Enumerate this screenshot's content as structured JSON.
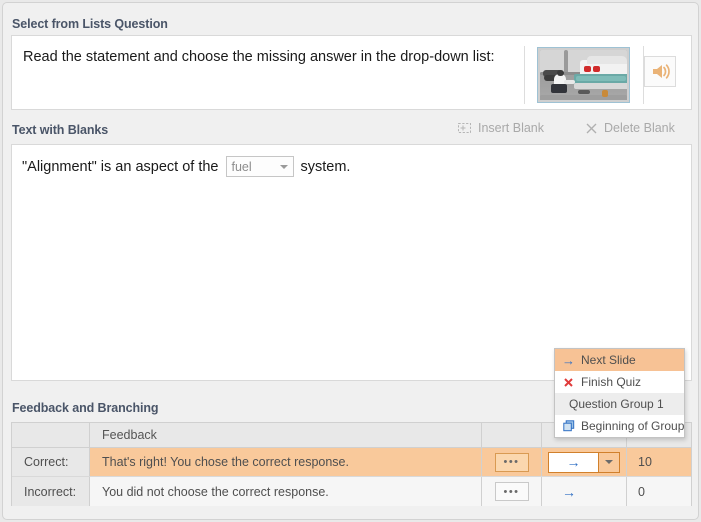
{
  "sections": {
    "question_title": "Select from Lists Question",
    "blanks_title": "Text with Blanks",
    "feedback_title": "Feedback and Branching"
  },
  "statement": {
    "text": "Read the statement and choose the missing answer in the drop-down list:",
    "image_icon": "car-repair-thumbnail",
    "audio_icon": "speaker-icon"
  },
  "blank_toolbar": {
    "insert_icon": "insert-blank-icon",
    "insert_label": "Insert Blank",
    "delete_icon": "close-x-icon",
    "delete_label": "Delete Blank"
  },
  "blanks": {
    "prefix": "\"Alignment\" is an aspect of the",
    "select_value": "fuel",
    "suffix": "system.",
    "chevron_icon": "chevron-down-icon"
  },
  "feedback_table": {
    "headers": [
      "",
      "Feedback",
      "",
      "",
      ""
    ],
    "feedback_header": "Feedback",
    "rows": [
      {
        "label": "Correct:",
        "feedback": "That's right! You chose the correct response.",
        "dots": "•••",
        "branch_icon": "arrow-right-icon",
        "chevron_icon": "chevron-down-icon",
        "score": "10"
      },
      {
        "label": "Incorrect:",
        "feedback": "You did not choose the correct response.",
        "dots": "•••",
        "branch_icon": "arrow-right-icon",
        "chevron_icon": "",
        "score": "0"
      }
    ]
  },
  "branch_popup": {
    "items": [
      {
        "label": "Next Slide",
        "icon": "arrow-right-icon",
        "selected": true
      },
      {
        "label": "Finish Quiz",
        "icon": "close-x-icon",
        "selected": false
      },
      {
        "label": "Question Group 1",
        "icon": "",
        "selected": false
      },
      {
        "label": "Beginning of Group",
        "icon": "layered-squares-icon",
        "selected": false
      }
    ]
  },
  "colors": {
    "accent_orange": "#f9c99b",
    "highlight_orange": "#f7c295",
    "header_text": "#4a5568",
    "link_blue": "#2f6fc4",
    "alert_red": "#e03b3b",
    "panel_bg": "#f0f0f0"
  }
}
